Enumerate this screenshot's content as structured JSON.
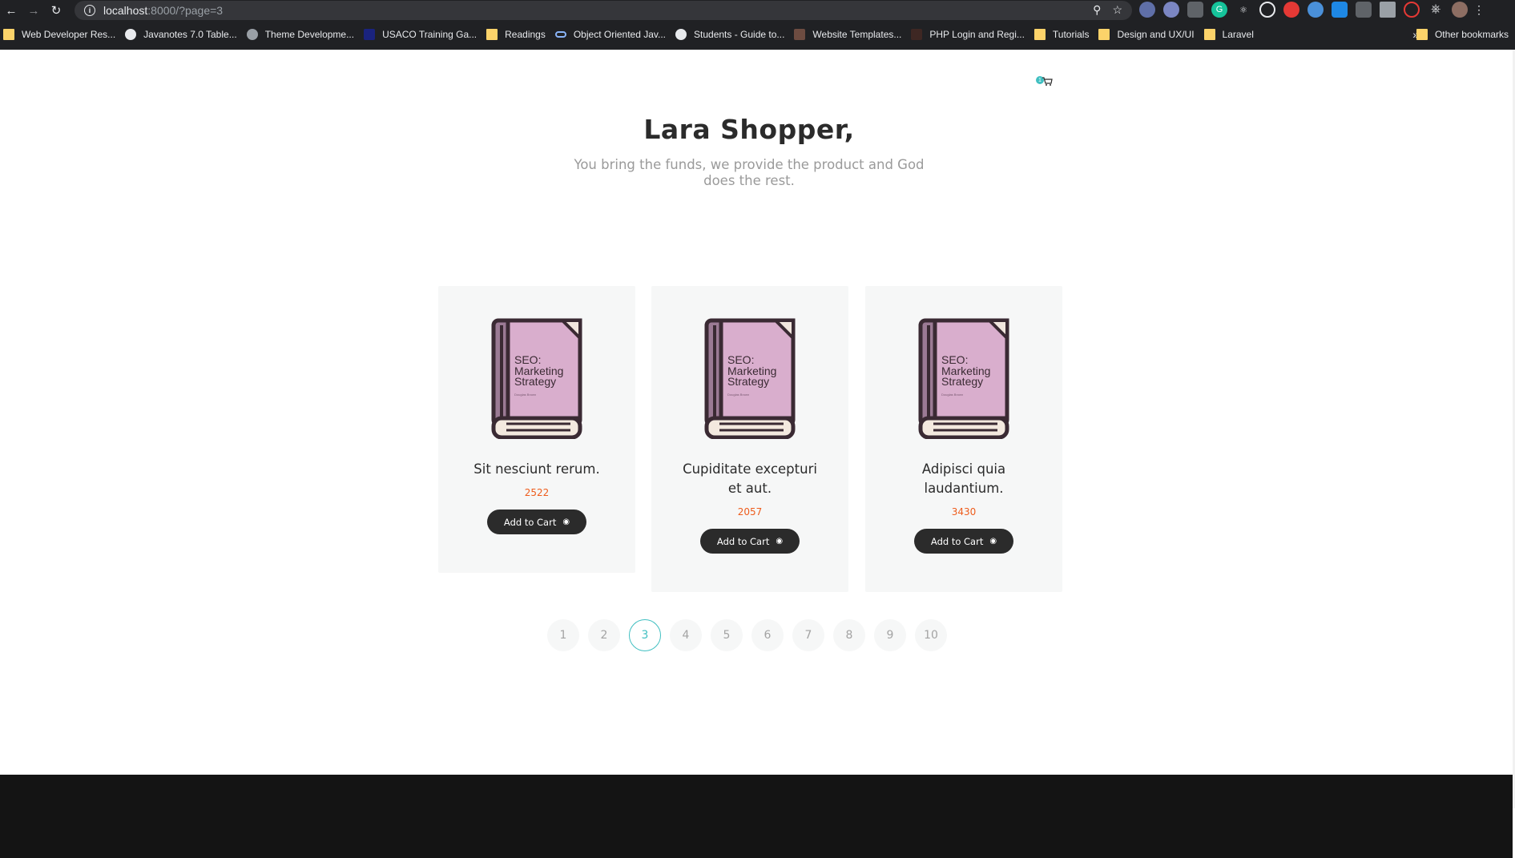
{
  "browser": {
    "url_host": "localhost",
    "url_path": ":8000/?page=3",
    "bookmarks": [
      {
        "label": "Web Developer Res...",
        "icon": "folder"
      },
      {
        "label": "Javanotes 7.0 Table...",
        "icon": "globe"
      },
      {
        "label": "Theme Developme...",
        "icon": "wordpress"
      },
      {
        "label": "USACO Training Ga...",
        "icon": "usaco"
      },
      {
        "label": "Readings",
        "icon": "folder"
      },
      {
        "label": "Object Oriented Jav...",
        "icon": "link"
      },
      {
        "label": "Students - Guide to...",
        "icon": "google"
      },
      {
        "label": "Website Templates...",
        "icon": "site"
      },
      {
        "label": "PHP Login and Regi...",
        "icon": "site"
      },
      {
        "label": "Tutorials",
        "icon": "folder"
      },
      {
        "label": "Design and UX/UI",
        "icon": "folder"
      },
      {
        "label": "Laravel",
        "icon": "folder"
      }
    ],
    "bookmarks_more": "»",
    "other_bookmarks": "Other bookmarks"
  },
  "cart": {
    "count": "1",
    "icon": "cart-icon"
  },
  "hero": {
    "title": "Lara Shopper,",
    "subtitle": "You bring the funds, we provide the product and God does the rest."
  },
  "book_cover": {
    "line1": "SEO:",
    "line2": "Marketing",
    "line3": "Strategy",
    "author": "Douglas Brown"
  },
  "products": [
    {
      "name": "Sit nesciunt rerum.",
      "price": "2522",
      "button": "Add to Cart"
    },
    {
      "name": "Cupiditate excepturi et aut.",
      "price": "2057",
      "button": "Add to Cart"
    },
    {
      "name": "Adipisci quia laudantium.",
      "price": "3430",
      "button": "Add to Cart"
    }
  ],
  "pagination": {
    "pages": [
      "1",
      "2",
      "3",
      "4",
      "5",
      "6",
      "7",
      "8",
      "9",
      "10"
    ],
    "current": "3"
  },
  "colors": {
    "accent": "#40bfc1",
    "price": "#ee5c1c",
    "button": "#2b2b2b",
    "card_bg": "#f6f7f7",
    "footer": "#141414"
  }
}
